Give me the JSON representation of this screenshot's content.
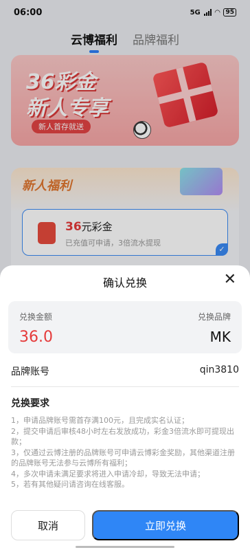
{
  "status": {
    "time": "06:00",
    "battery": "95",
    "network": "5G"
  },
  "tabs": [
    {
      "label": "云博福利",
      "active": true
    },
    {
      "label": "品牌福利",
      "active": false
    }
  ],
  "banner": {
    "title_line1": "36彩金",
    "title_line2": "新人专享",
    "pill": "新人首存就送"
  },
  "new_user": {
    "title": "新人福利",
    "card": {
      "amount": "36",
      "unit": "元彩金",
      "desc": "已充值可申请，3倍流水提现"
    }
  },
  "sheet": {
    "title": "确认兑换",
    "close_icon": "close-icon",
    "amount_label": "兑换金额",
    "amount_value": "36.0",
    "brand_label": "兑换品牌",
    "brand_value": "MK",
    "account_label": "品牌账号",
    "account_value": "qin3810",
    "requirements_title": "兑换要求",
    "requirements": [
      "1，申请品牌账号需首存满100元，且完成实名认证；",
      "2，提交申请后审核48小时左右发放成功，彩金3倍流水即可提现出款；",
      "3，仅通过云博注册的品牌账号可申请云博彩金奖励，其他渠道注册的品牌账号无法参与云博所有福利；",
      "4，多次申请未满足要求将进入申请冷却，导致无法申请；",
      "5，若有其他疑问请咨询在线客服。"
    ],
    "cancel_label": "取消",
    "confirm_label": "立即兑换"
  },
  "colors": {
    "accent": "#2f86f6",
    "amount_red": "#e53a3a"
  }
}
